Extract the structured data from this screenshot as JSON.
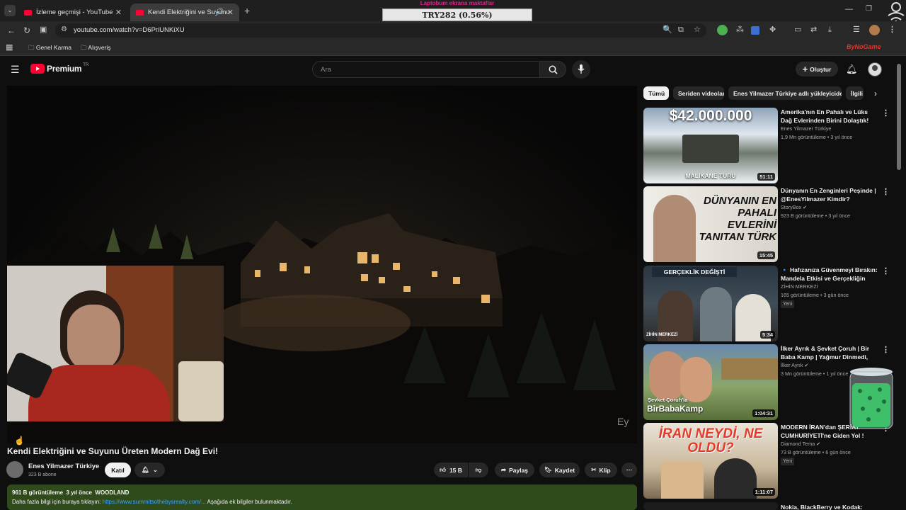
{
  "browser": {
    "tabs": [
      {
        "title": "İzleme geçmişi - YouTube",
        "active": false
      },
      {
        "title": "Kendi Elektriğini ve Suyunu",
        "active": true
      }
    ],
    "url": "youtube.com/watch?v=D6PriUNKiXU",
    "bookmarks": [
      "Genel Karma",
      "Alışveriş"
    ],
    "overlay_ticker": {
      "top": "Laptobum ekrana maktaflar",
      "value": "TRY282 (0.56%)"
    },
    "watermark": "ByNoGame"
  },
  "youtube": {
    "logo_text": "Premium",
    "logo_badge": "TR",
    "search_placeholder": "Ara",
    "create_label": "Oluştur",
    "video": {
      "title": "Kendi Elektriğini ve Suyunu Üreten Modern Dağ Evi!",
      "channel": "Enes Yilmazer Türkiye",
      "subscribers": "323 B abone",
      "join_label": "Katıl",
      "likes": "15 B",
      "share_label": "Paylaş",
      "save_label": "Kaydet",
      "clip_label": "Klip",
      "views": "961 B görüntüleme",
      "age": "3 yıl önce",
      "tag": "WOODLAND",
      "desc_prefix": "Daha fazla bilgi için buraya tıklayın:",
      "desc_link": "https://www.summitsothebysrealty.com/...",
      "desc_suffix": "Aşağıda ek bilgiler bulunmaktadır."
    },
    "chips": [
      "Tümü",
      "Seriden videolar",
      "Enes Yilmazer Türkiye adlı yükleyiciden",
      "İlgili"
    ],
    "recommendations": [
      {
        "title": "Amerika'nın En Pahalı ve Lüks Dağ Evlerinden Birini Dolaştık!",
        "channel": "Enes Yilmazer Türkiye",
        "meta": "1,9 Mn görüntüleme • 3 yıl önce",
        "duration": "51:11",
        "thumb_top": "$42.000.000",
        "thumb_bottom": "MALİKANE TURU",
        "badge": ""
      },
      {
        "title": "Dünyanın En Zenginleri Peşinde | @EnesYilmazer Kimdir?",
        "channel": "StoryBox",
        "meta": "923 B görüntüleme • 3 yıl önce",
        "duration": "15:45",
        "thumb_top": "DÜNYANIN EN PAHALI EVLERİNİ TANITAN TÜRK",
        "thumb_bottom": "",
        "badge": ""
      },
      {
        "title": "🔹 Hafızanıza Güvenmeyi Bırakın: Mandela Etkisi ve Gerçekliğin Sonu",
        "channel": "ZİHİN MERKEZİ",
        "meta": "165 görüntüleme • 3 gün önce",
        "duration": "5:34",
        "thumb_top": "GERÇEKLİK DEĞİŞTİ",
        "thumb_bottom": "ZİHİN MERKEZİ",
        "badge": "Yeni"
      },
      {
        "title": "İlker Ayrık & Şevket Çoruh | Bir Baba Kamp | Yağmur Dinmedi, Ateş ...",
        "channel": "İlker Ayrık",
        "meta": "3 Mn görüntüleme • 1 yıl önce",
        "duration": "1:04:31",
        "thumb_top": "Şevket Çoruh'la",
        "thumb_bottom": "BirBabaKamp",
        "badge": ""
      },
      {
        "title": "MODERN İRAN'dan ŞERİAT CUMHURİYETİ'ne Giden Yol !",
        "channel": "Diamond Tema",
        "meta": "73 B görüntüleme • 6 gün önce",
        "duration": "1:11:07",
        "thumb_top": "İRAN NEYDİ, NE OLDU?",
        "thumb_bottom": "",
        "badge": "Yeni"
      },
      {
        "title": "Nokia, BlackBerry ve Kodak:",
        "channel": "",
        "meta": "",
        "duration": "",
        "thumb_top": "",
        "thumb_bottom": "",
        "badge": ""
      }
    ]
  },
  "colors": {
    "youtube_red": "#ff0033",
    "link_blue": "#3ea6ff",
    "desc_bg": "#2f4a1b",
    "ticker_magenta": "#e0208a"
  }
}
